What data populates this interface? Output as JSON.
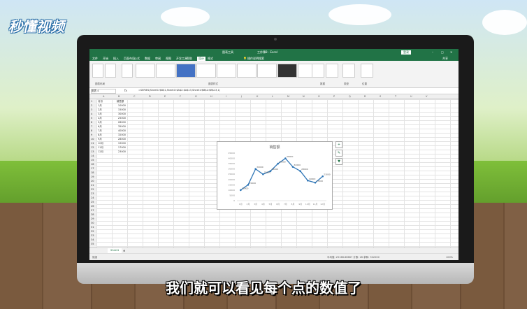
{
  "branding": {
    "logo_text": "秒懂视频"
  },
  "subtitle": "我们就可以看见每个点的数值了",
  "excel": {
    "title_center": "工作簿8 - Excel",
    "chart_tools_label": "图表工具",
    "login_label": "登录",
    "share_label": "共享",
    "tabs": [
      "文件",
      "开始",
      "插入",
      "页面布局",
      "公式",
      "数据",
      "审阅",
      "视图",
      "开发工具",
      "帮助",
      "设计",
      "格式"
    ],
    "active_tab": "设计",
    "tell_me": "操作说明搜索",
    "ribbon_groups": [
      "图表布局",
      "图表样式",
      "数据",
      "类型",
      "位置"
    ],
    "ribbon_buttons": [
      "添加图表元素",
      "快速布局",
      "更改颜色",
      "切换行/列",
      "选择数据",
      "更改图表类型",
      "移动图表"
    ],
    "name_box": "图表 4",
    "formula": "=SERIES(Sheet1!$B$1,Sheet1!$A$2:$A$13,Sheet1!$B$2:$B$13,1)",
    "columns": [
      "A",
      "B",
      "C",
      "D",
      "E",
      "F",
      "G",
      "H",
      "I",
      "J",
      "K",
      "L",
      "M",
      "N",
      "O",
      "P",
      "Q",
      "R",
      "S",
      "T",
      "U",
      "V"
    ],
    "header_row": {
      "a": "月份",
      "b": "销售额"
    },
    "months": [
      "1月",
      "2月",
      "3月",
      "4月",
      "5月",
      "6月",
      "7月",
      "8月",
      "9月",
      "10月",
      "11月",
      "12月"
    ],
    "sales": [
      10000,
      15000,
      30000,
      25000,
      28000,
      35000,
      40000,
      32000,
      28000,
      19000,
      17000,
      23000
    ],
    "sheet_tab": "Sheet1",
    "status_left": "就绪",
    "status_stats": "平均值: 25166.66667   计数: 26   求和: 302000",
    "zoom": "100%"
  },
  "chart_data": {
    "type": "line",
    "title": "销售额",
    "categories": [
      "1月",
      "2月",
      "3月",
      "4月",
      "5月",
      "6月",
      "7月",
      "8月",
      "9月",
      "10月",
      "11月",
      "12月"
    ],
    "values": [
      10000,
      15000,
      30000,
      25000,
      28000,
      35000,
      40000,
      32000,
      28000,
      19000,
      17000,
      23000
    ],
    "ylim": [
      0,
      45000
    ],
    "yticks": [
      0,
      5000,
      10000,
      15000,
      20000,
      25000,
      30000,
      35000,
      40000,
      45000
    ],
    "data_labels": true,
    "line_color": "#2e75b6",
    "grid": false
  }
}
